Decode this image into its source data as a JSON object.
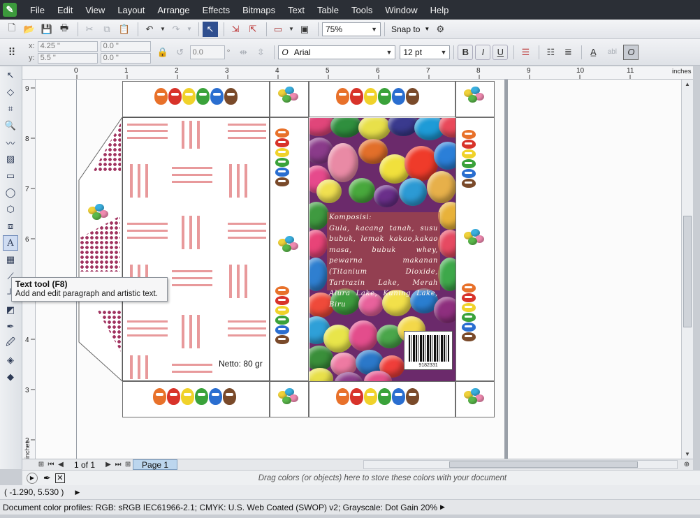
{
  "menubar": {
    "items": [
      "File",
      "Edit",
      "View",
      "Layout",
      "Arrange",
      "Effects",
      "Bitmaps",
      "Text",
      "Table",
      "Tools",
      "Window",
      "Help"
    ]
  },
  "toolbar": {
    "zoom": "75%",
    "snap_to": "Snap to"
  },
  "property_bar": {
    "x_label": "x:",
    "x_value": "4.25 \"",
    "y_label": "y:",
    "y_value": "5.5 \"",
    "w_value": "0.0 \"",
    "h_value": "0.0 \"",
    "rotation": "0.0",
    "rotation_unit": "°",
    "font_name": "Arial",
    "font_size": "12 pt",
    "font_icon": "O",
    "bold": "B",
    "italic": "I",
    "underline": "U",
    "text_abl": "abl"
  },
  "ruler": {
    "units": "inches",
    "h_ticks": [
      "0",
      "1",
      "2",
      "3",
      "4",
      "5",
      "6",
      "7",
      "8",
      "9",
      "10",
      "11"
    ],
    "v_ticks": [
      "9",
      "8",
      "7",
      "6",
      "5",
      "4",
      "3",
      "2"
    ],
    "corner_label": "inches"
  },
  "tooltip": {
    "title": "Text tool (F8)",
    "description": "Add and edit paragraph and artistic text."
  },
  "document": {
    "composition_title": "Komposisi:",
    "composition_body": "Gula, kacang tanah, susu bubuk, lemak kakao,kakao masa, bubuk whey, pewarna makanan (Titanium Dioxide, Tartrazin Lake, Merah Alura Lake, Kuning Lake, Biru",
    "netto": "Netto: 80 gr",
    "barcode_number": "9182331"
  },
  "pagebar": {
    "page_count": "1 of 1",
    "page_tab": "Page 1"
  },
  "color_docker": {
    "message": "Drag colors (or objects) here to store these colors with your document"
  },
  "status": {
    "cursor_position": "( -1.290, 5.530 )",
    "color_profiles": "Document color profiles: RGB: sRGB IEC61966-2.1; CMYK: U.S. Web Coated (SWOP) v2; Grayscale: Dot Gain 20%"
  },
  "colors": {
    "stripe": "#e8999b",
    "tab_dots": "#a0325f",
    "menubar_bg": "#2b2f36"
  }
}
